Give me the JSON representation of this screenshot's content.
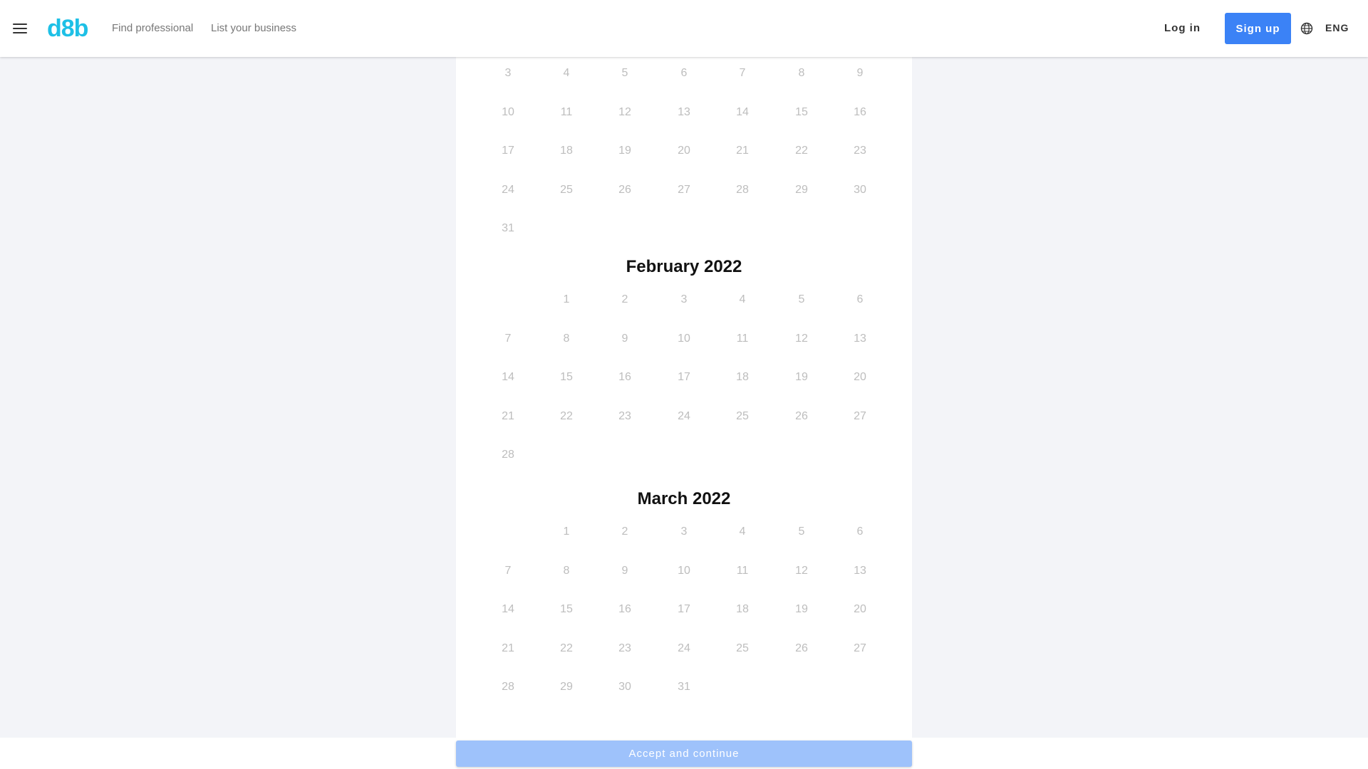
{
  "header": {
    "logo": "d8b",
    "nav": [
      "Find professional",
      "List your business"
    ],
    "login_label": "Log in",
    "signup_label": "Sign up",
    "language": "ENG",
    "accent_color": "#3b82f6",
    "logo_color": "#1ec0e6"
  },
  "calendar": {
    "partial_month_weeks": [
      [
        "3",
        "4",
        "5",
        "6",
        "7",
        "8",
        "9"
      ],
      [
        "10",
        "11",
        "12",
        "13",
        "14",
        "15",
        "16"
      ],
      [
        "17",
        "18",
        "19",
        "20",
        "21",
        "22",
        "23"
      ],
      [
        "24",
        "25",
        "26",
        "27",
        "28",
        "29",
        "30"
      ],
      [
        "31",
        "",
        "",
        "",
        "",
        "",
        ""
      ]
    ],
    "months": [
      {
        "title": "February 2022",
        "weeks": [
          [
            "",
            "1",
            "2",
            "3",
            "4",
            "5",
            "6"
          ],
          [
            "7",
            "8",
            "9",
            "10",
            "11",
            "12",
            "13"
          ],
          [
            "14",
            "15",
            "16",
            "17",
            "18",
            "19",
            "20"
          ],
          [
            "21",
            "22",
            "23",
            "24",
            "25",
            "26",
            "27"
          ],
          [
            "28",
            "",
            "",
            "",
            "",
            "",
            ""
          ]
        ]
      },
      {
        "title": "March 2022",
        "weeks": [
          [
            "",
            "1",
            "2",
            "3",
            "4",
            "5",
            "6"
          ],
          [
            "7",
            "8",
            "9",
            "10",
            "11",
            "12",
            "13"
          ],
          [
            "14",
            "15",
            "16",
            "17",
            "18",
            "19",
            "20"
          ],
          [
            "21",
            "22",
            "23",
            "24",
            "25",
            "26",
            "27"
          ],
          [
            "28",
            "29",
            "30",
            "31",
            "",
            "",
            ""
          ]
        ]
      }
    ]
  },
  "footer": {
    "accept_label": "Accept and continue"
  }
}
